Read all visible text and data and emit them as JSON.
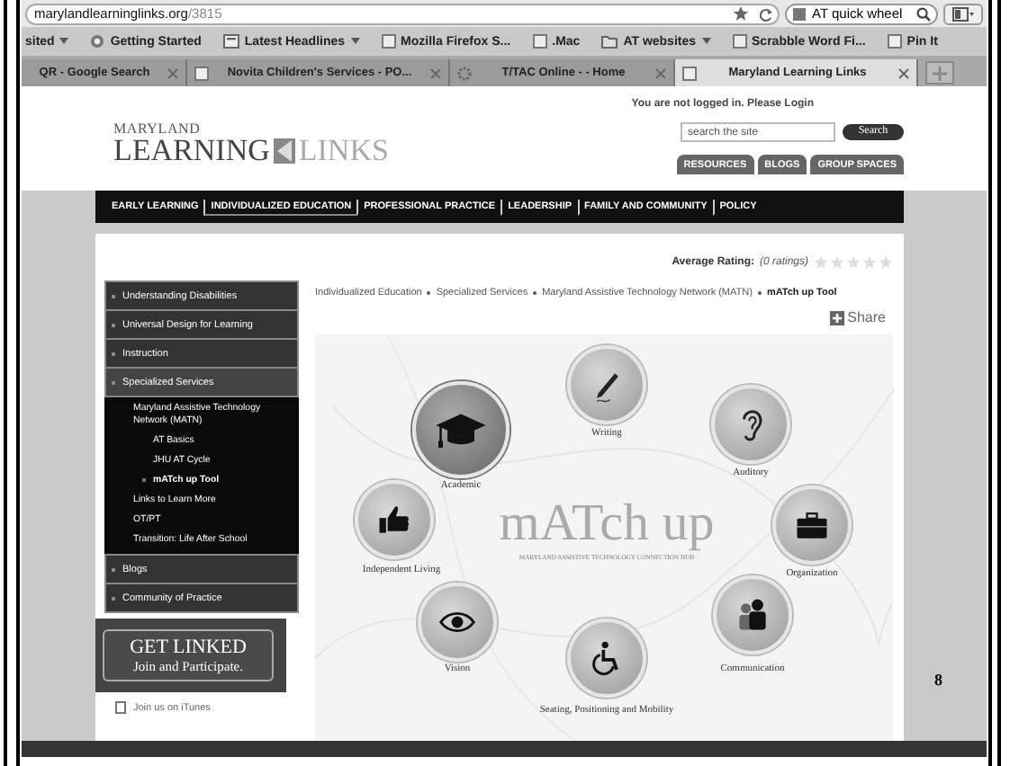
{
  "browser": {
    "url_host": "marylandlearninglinks.org",
    "url_path": "/3815",
    "search_value": "AT quick wheel",
    "bookmarks": [
      {
        "label": "sited",
        "kind": "plain",
        "dropdown": true
      },
      {
        "label": "Getting Started",
        "kind": "badge",
        "dropdown": false
      },
      {
        "label": "Latest Headlines",
        "kind": "feed",
        "dropdown": true
      },
      {
        "label": "Mozilla Firefox S...",
        "kind": "page",
        "dropdown": false
      },
      {
        "label": ".Mac",
        "kind": "page",
        "dropdown": false
      },
      {
        "label": "AT websites",
        "kind": "folder",
        "dropdown": true
      },
      {
        "label": "Scrabble Word Fi...",
        "kind": "page",
        "dropdown": false
      },
      {
        "label": "Pin It",
        "kind": "page",
        "dropdown": false
      }
    ],
    "tabs": [
      {
        "label": "QR - Google Search",
        "kind": "plain",
        "selected": false
      },
      {
        "label": "Novita Children's Services - PO...",
        "kind": "page",
        "selected": false
      },
      {
        "label": "T/TAC Online - - Home",
        "kind": "gear",
        "selected": false
      },
      {
        "label": "Maryland Learning Links",
        "kind": "page",
        "selected": true
      }
    ]
  },
  "site": {
    "login_text": "You are not logged in. Please Login",
    "logo": {
      "top": "MARYLAND",
      "left": "LEARNING",
      "right": "LINKS"
    },
    "search": {
      "placeholder": "search the site",
      "button": "Search"
    },
    "top_tabs": [
      "RESOURCES",
      "BLOGS",
      "GROUP SPACES"
    ],
    "nav": [
      {
        "label": "EARLY LEARNING",
        "selected": false
      },
      {
        "label": "INDIVIDUALIZED EDUCATION",
        "selected": true
      },
      {
        "label": "PROFESSIONAL PRACTICE",
        "selected": false
      },
      {
        "label": "LEADERSHIP",
        "selected": false
      },
      {
        "label": "FAMILY AND COMMUNITY",
        "selected": false
      },
      {
        "label": "POLICY",
        "selected": false
      }
    ],
    "rating": {
      "label": "Average Rating:",
      "count": "(0 ratings)",
      "stars": 0
    },
    "sidebar": [
      {
        "label": "Understanding Disabilities",
        "expanded": false
      },
      {
        "label": "Universal Design for Learning",
        "expanded": false
      },
      {
        "label": "Instruction",
        "expanded": false
      },
      {
        "label": "Specialized Services",
        "expanded": true,
        "children": [
          {
            "label": "Maryland Assistive Technology Network (MATN)",
            "selected": false,
            "children": [
              {
                "label": "AT Basics",
                "selected": false
              },
              {
                "label": "JHU AT Cycle",
                "selected": false
              },
              {
                "label": "mATch up Tool",
                "selected": true
              }
            ]
          },
          {
            "label": "Links to Learn More",
            "selected": false
          },
          {
            "label": "OT/PT",
            "selected": false
          },
          {
            "label": "Transition: Life After School",
            "selected": false
          }
        ]
      },
      {
        "label": "Blogs",
        "expanded": false
      },
      {
        "label": "Community of Practice",
        "expanded": false
      }
    ],
    "banner": {
      "title": "GET LINKED",
      "subtitle": "Join and Participate."
    },
    "itunes": "Join us on iTunes",
    "breadcrumb": [
      {
        "label": "Individualized Education",
        "current": false
      },
      {
        "label": "Specialized Services",
        "current": false
      },
      {
        "label": "Maryland Assistive Technology Network (MATN)",
        "current": false
      },
      {
        "label": "mATch up Tool",
        "current": true
      }
    ],
    "share": "Share",
    "matchup": {
      "title": "mATch up",
      "subtitle": "MARYLAND ASSISTIVE TECHNOLOGY CONNECTION HUB",
      "categories": [
        {
          "label": "Writing",
          "kind": "pen",
          "selected": false
        },
        {
          "label": "Academic",
          "kind": "cap",
          "selected": true
        },
        {
          "label": "Auditory",
          "kind": "ear",
          "selected": false
        },
        {
          "label": "Independent Living",
          "kind": "thumb",
          "selected": false
        },
        {
          "label": "Organization",
          "kind": "briefcase",
          "selected": false
        },
        {
          "label": "Vision",
          "kind": "eye",
          "selected": false
        },
        {
          "label": "Communication",
          "kind": "people",
          "selected": false
        },
        {
          "label": "Seating, Positioning and Mobility",
          "kind": "wheelchair",
          "selected": false
        }
      ]
    }
  },
  "page_number": "8"
}
